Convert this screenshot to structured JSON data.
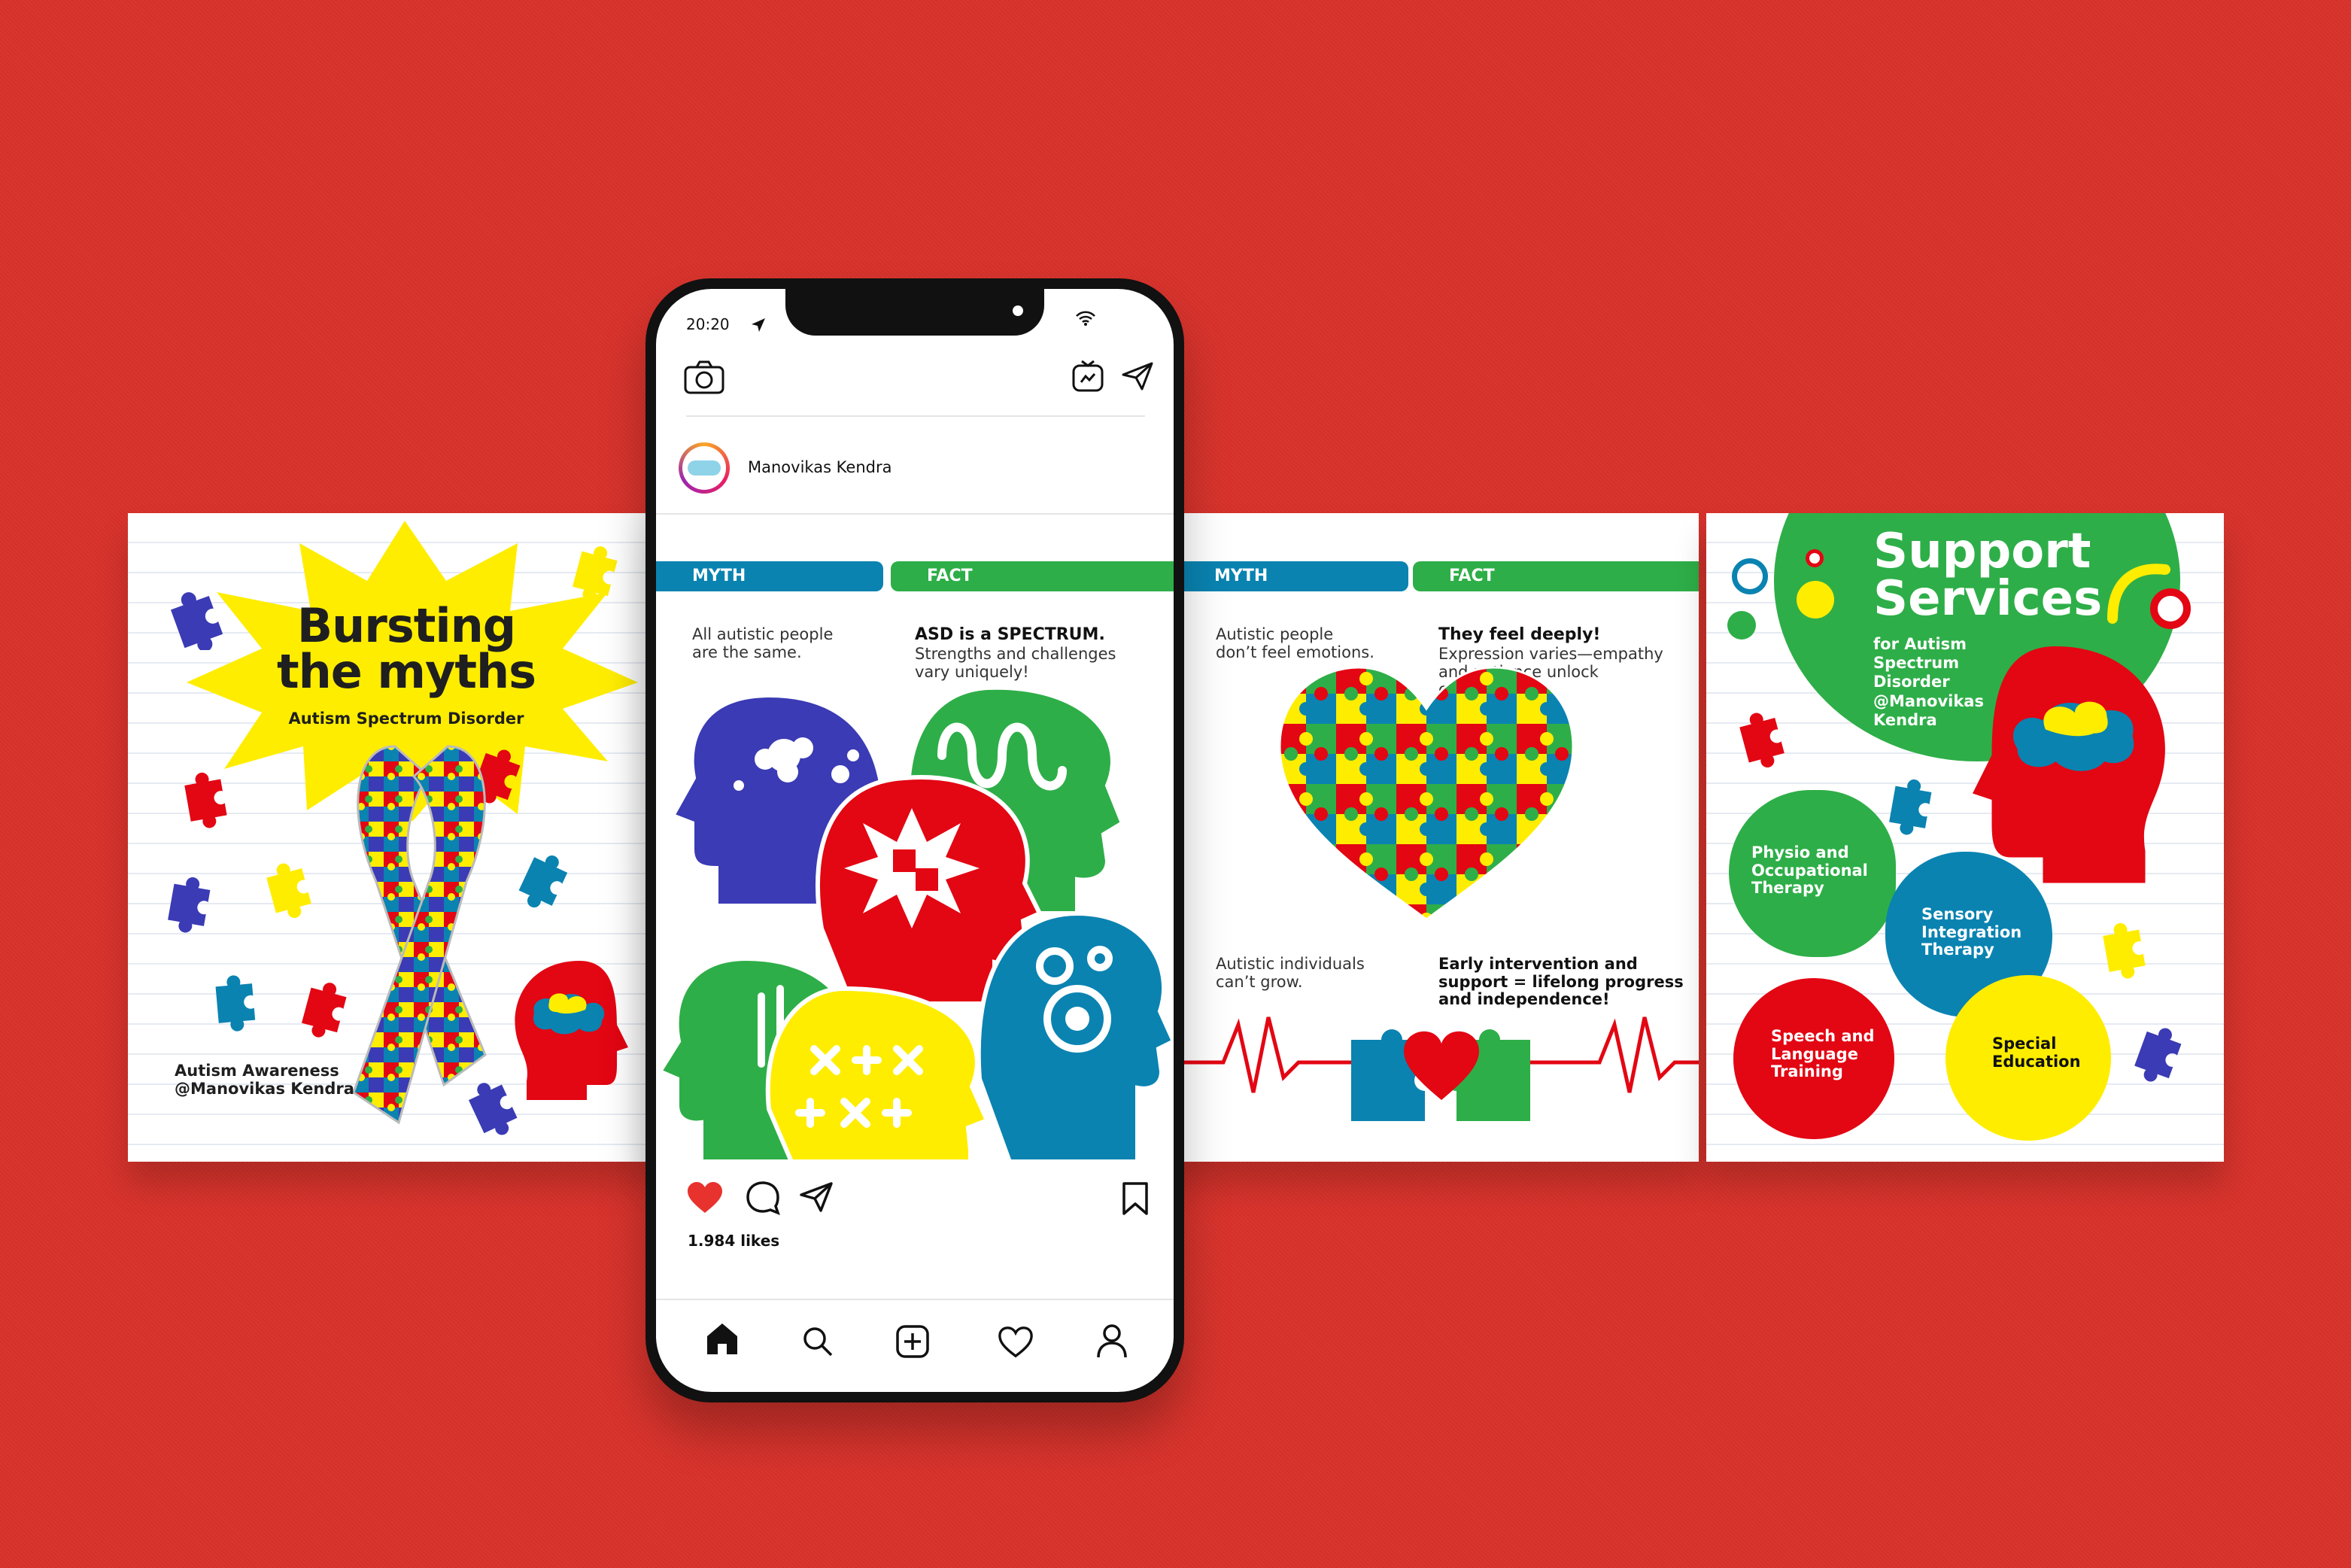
{
  "colors": {
    "background": "#d8322b",
    "red": "#e30613",
    "yellow": "#ffed00",
    "green": "#2eae48",
    "blue": "#0a83b1",
    "purple": "#3b3bb5",
    "myth_bar": "#0a83b1",
    "fact_bar": "#2eae48",
    "heart": "#e8322d"
  },
  "card1": {
    "title": "Bursting\nthe myths",
    "subtitle": "Autism Spectrum Disorder",
    "footer": "Autism Awareness\n@Manovikas Kendra"
  },
  "phone": {
    "status_time": "20:20",
    "profile_name": "Manovikas Kendra",
    "post": {
      "myth_label": "MYTH",
      "fact_label": "FACT",
      "myth_text": "All autistic people\nare the same.",
      "fact_title": "ASD is a SPECTRUM.",
      "fact_text": "Strengths and challenges\nvary uniquely!"
    },
    "likes": "1.984 likes",
    "icons": {
      "camera": "camera-icon",
      "igtv": "igtv-icon",
      "direct": "send-icon",
      "like": "heart-icon",
      "comment": "comment-icon",
      "share": "share-icon",
      "save": "bookmark-icon",
      "home": "home-icon",
      "search": "search-icon",
      "add": "add-post-icon",
      "activity": "activity-heart-icon",
      "profile": "profile-icon"
    }
  },
  "card3": {
    "myth_label": "MYTH",
    "fact_label": "FACT",
    "myth1": "Autistic people\ndon’t feel emotions.",
    "fact1_title": "They feel deeply!",
    "fact1_text": "Expression varies—empathy\nand patience unlock\nconnection.",
    "myth2": "Autistic individuals\ncan’t grow.",
    "fact2": "Early intervention and\nsupport = lifelong progress\nand independence!"
  },
  "card4": {
    "title": "Support\nServices",
    "subtitle": "for Autism\nSpectrum\nDisorder\n@Manovikas\nKendra",
    "services": [
      "Physio and\nOccupational\nTherapy",
      "Sensory\nIntegration\nTherapy",
      "Speech and\nLanguage\nTraining",
      "Special\nEducation"
    ]
  }
}
